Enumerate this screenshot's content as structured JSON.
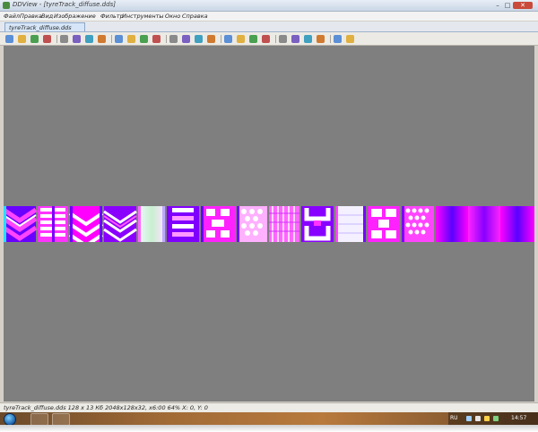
{
  "window": {
    "title": "DDView - [tyreTrack_diffuse.dds]"
  },
  "menu": {
    "items": [
      "Файл",
      "Правка",
      "Вид",
      "Изображение",
      "Фильтр",
      "Инструменты",
      "Окно",
      "Справка"
    ]
  },
  "tabs": [
    {
      "label": "tyreTrack_diffuse.dds"
    }
  ],
  "toolbar": {
    "icons": [
      "new-icon",
      "open-icon",
      "save-icon",
      "save-as-icon",
      "print-icon",
      "cut-icon",
      "copy-icon",
      "paste-icon",
      "undo-icon",
      "redo-icon",
      "rotate-icon",
      "zoom-in-icon",
      "zoom-out-icon",
      "zoom-fit-icon",
      "back-icon",
      "forward-icon",
      "view-icon",
      "thumbnail-icon",
      "folder-icon",
      "export-icon",
      "grid-icon",
      "scan-icon",
      "camera-icon",
      "settings-icon",
      "info-icon",
      "help-icon"
    ]
  },
  "status": {
    "text": "tyreTrack_diffuse.dds   128 x 13 Кб   2048x128x32, x6:00   64%   X: 0, Y: 0"
  },
  "taskbar": {
    "language": "RU",
    "clock": "14:57"
  },
  "colors": {
    "canvas": "#7f7f7f",
    "magenta": "#ff00ff",
    "purple": "#6a00ff",
    "cyan": "#19d7ff"
  }
}
